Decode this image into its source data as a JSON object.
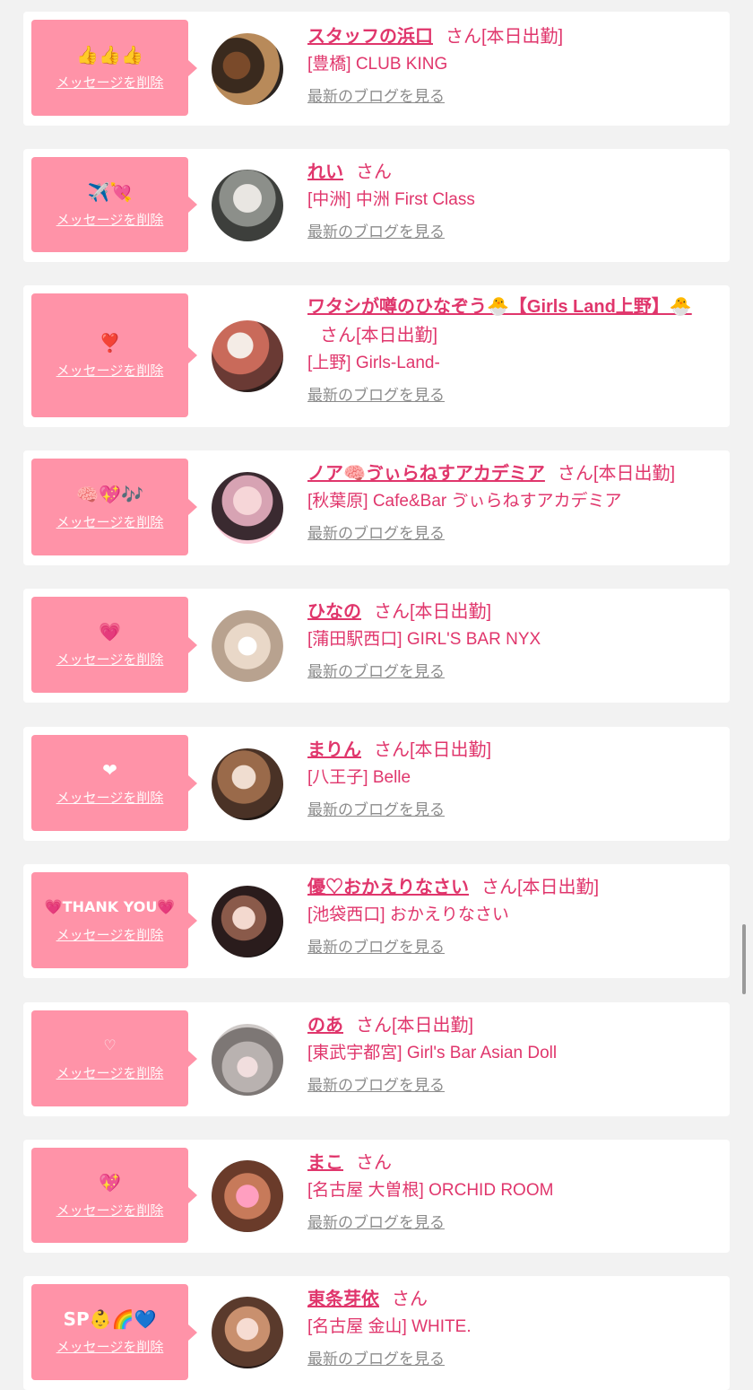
{
  "entries": [
    {
      "message": "👍👍👍",
      "delete_label": "メッセージを削除",
      "name": "スタッフの浜口",
      "suffix": "さん",
      "status": "[本日出勤]",
      "shop": "[豊橋] CLUB KING",
      "blog_link": "最新のブログを見る"
    },
    {
      "message": "✈️💘",
      "delete_label": "メッセージを削除",
      "name": "れい",
      "suffix": "さん",
      "status": "",
      "shop": "[中洲] 中洲 First Class",
      "blog_link": "最新のブログを見る"
    },
    {
      "message": "❣️",
      "delete_label": "メッセージを削除",
      "name": "ワタシが噂のひなぞう🐣【Girls Land上野】🐣",
      "suffix": "さん",
      "status": "[本日出勤]",
      "shop": "[上野] Girls-Land-",
      "blog_link": "最新のブログを見る"
    },
    {
      "message": "🧠💖🎶",
      "delete_label": "メッセージを削除",
      "name": "ノア🧠ゔぃらねすアカデミア",
      "suffix": "さん",
      "status": "[本日出勤]",
      "shop": "[秋葉原] Cafe&Bar ゔぃらねすアカデミア",
      "blog_link": "最新のブログを見る"
    },
    {
      "message": "💗",
      "delete_label": "メッセージを削除",
      "name": "ひなの",
      "suffix": "さん",
      "status": "[本日出勤]",
      "shop": "[蒲田駅西口] GIRL'S BAR NYX",
      "blog_link": "最新のブログを見る"
    },
    {
      "message": "❤",
      "delete_label": "メッセージを削除",
      "name": "まりん",
      "suffix": "さん",
      "status": "[本日出勤]",
      "shop": "[八王子] Belle",
      "blog_link": "最新のブログを見る"
    },
    {
      "message": "💗THANK YOU💗",
      "delete_label": "メッセージを削除",
      "name": "優♡おかえりなさい",
      "suffix": "さん",
      "status": "[本日出勤]",
      "shop": "[池袋西口] おかえりなさい",
      "blog_link": "最新のブログを見る"
    },
    {
      "message": "♡",
      "delete_label": "メッセージを削除",
      "name": "のあ",
      "suffix": "さん",
      "status": "[本日出勤]",
      "shop": "[東武宇都宮] Girl's Bar Asian Doll",
      "blog_link": "最新のブログを見る"
    },
    {
      "message": "💖",
      "delete_label": "メッセージを削除",
      "name": "まこ",
      "suffix": "さん",
      "status": "",
      "shop": "[名古屋 大曽根] ORCHID ROOM",
      "blog_link": "最新のブログを見る"
    },
    {
      "message": "SP👶🌈💙",
      "delete_label": "メッセージを削除",
      "name": "東条芽依",
      "suffix": "さん",
      "status": "",
      "shop": "[名古屋 金山] WHITE.",
      "blog_link": "最新のブログを見る"
    }
  ],
  "colors": {
    "accent": "#e0366c",
    "bubble": "#ff93a8",
    "link_gray": "#8c8c8c",
    "background": "#f2f2f2"
  }
}
